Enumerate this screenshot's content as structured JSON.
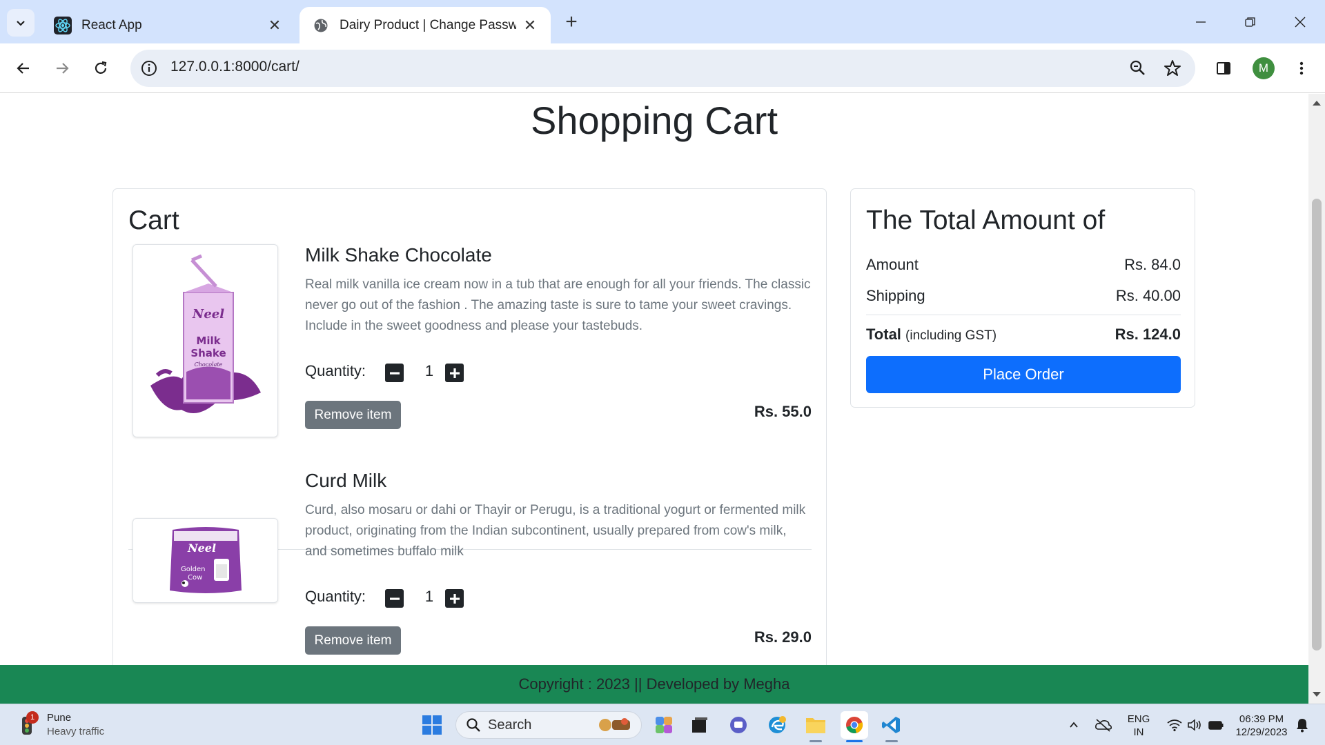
{
  "browser": {
    "tabs": [
      {
        "title": "React App",
        "active": false
      },
      {
        "title": "Dairy Product | Change Passwor",
        "active": true
      }
    ],
    "url": "127.0.0.1:8000/cart/",
    "profile_initial": "M"
  },
  "page": {
    "title": "Shopping Cart",
    "cart": {
      "heading": "Cart",
      "quantity_label": "Quantity:",
      "remove_label": "Remove item",
      "items": [
        {
          "name": "Milk Shake Chocolate",
          "description": "Real milk vanilla ice cream now in a tub that are enough for all your friends. The classic never go out of the fashion . The amazing taste is sure to tame your sweet cravings. Include in the sweet goodness and please your tastebuds.",
          "quantity": "1",
          "price": "Rs. 55.0",
          "image_label": "Neel Milk Shake Chocolate"
        },
        {
          "name": "Curd Milk",
          "description": "Curd, also mosaru or dahi or Thayir or Perugu, is a traditional yogurt or fermented milk product, originating from the Indian subcontinent, usually prepared from cow's milk, and sometimes buffalo milk",
          "quantity": "1",
          "price": "Rs. 29.0",
          "image_label": "Neel Golden Cow Milk"
        }
      ]
    },
    "summary": {
      "title": "The Total Amount of",
      "amount_label": "Amount",
      "amount_value": "Rs. 84.0",
      "shipping_label": "Shipping",
      "shipping_value": "Rs. 40.00",
      "total_label": "Total",
      "total_note": "(including GST)",
      "total_value": "Rs. 124.0",
      "place_order": "Place Order"
    },
    "footer": "Copyright : 2023 || Developed by Megha"
  },
  "taskbar": {
    "weather_city": "Pune",
    "weather_status": "Heavy traffic",
    "weather_badge": "1",
    "search_label": "Search",
    "lang_top": "ENG",
    "lang_bottom": "IN",
    "time": "06:39 PM",
    "date": "12/29/2023"
  },
  "colors": {
    "primary": "#0d6efd",
    "secondary": "#6c757d",
    "footer": "#198754",
    "tabstrip": "#d3e3fd"
  }
}
